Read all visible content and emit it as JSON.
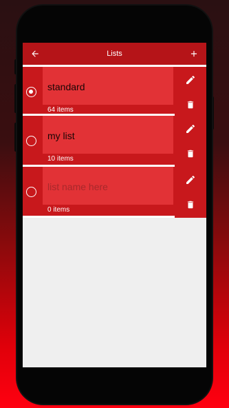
{
  "appbar": {
    "title": "Lists",
    "back_icon": "arrow-left-icon",
    "add_icon": "plus-icon"
  },
  "lists": [
    {
      "name": "standard",
      "placeholder": "",
      "count": "64 items",
      "selected": true
    },
    {
      "name": "my list",
      "placeholder": "",
      "count": "10 items",
      "selected": false
    },
    {
      "name": "",
      "placeholder": "list name here",
      "count": "0 items",
      "selected": false
    }
  ],
  "colors": {
    "appbar": "#b51418",
    "row": "#c8181c",
    "name_box": "#e23236",
    "screen_bg": "#efefef"
  }
}
